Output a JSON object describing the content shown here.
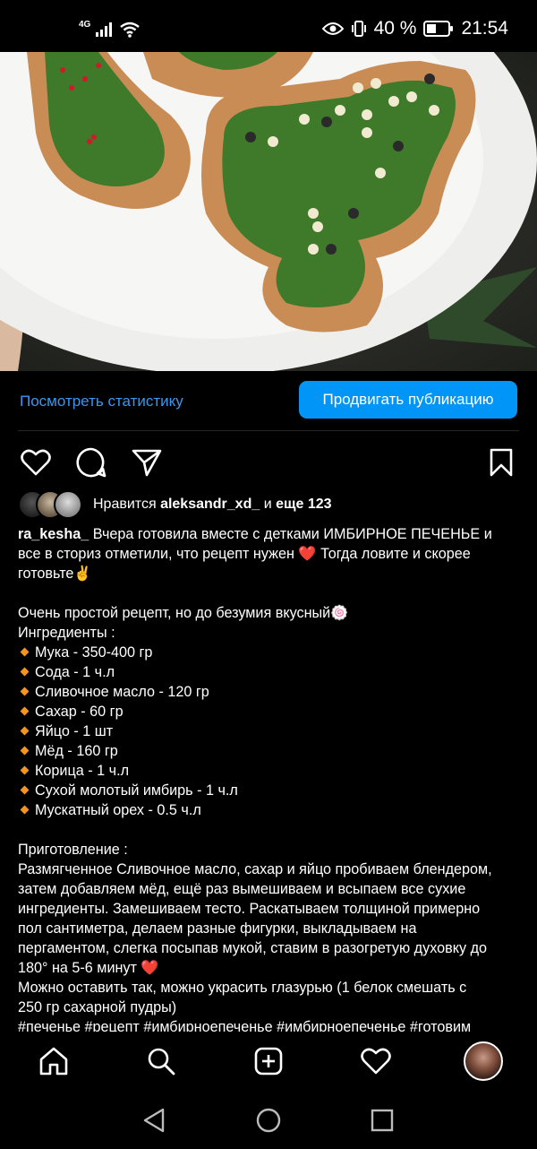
{
  "status_bar": {
    "network": "4G",
    "battery": "40 %",
    "time": "21:54"
  },
  "post": {
    "image_icon": "gingerbread-cookies-photo",
    "stats_link": "Посмотреть статистику",
    "promote_button": "Продвигать публикацию",
    "likes": {
      "prefix": "Нравится",
      "user": "aleksandr_xd_",
      "middle": "и",
      "more": "еще 123"
    },
    "caption": {
      "username": "ra_kesha_",
      "first_line": "Вчера готовила вместе с детками ИМБИРНОЕ ПЕЧЕНЬЕ и",
      "lines": [
        "все в сториз отметили, что рецепт нужен ❤️ Тогда ловите и скорее",
        "готовьте✌️",
        "",
        "Очень простой рецепт, но до безумия вкусный🍥",
        "Ингредиенты :"
      ],
      "ingredients": [
        "Мука - 350-400 гр",
        "Сода - 1 ч.л",
        "Сливочное масло - 120 гр",
        "Сахар - 60 гр",
        "Яйцо - 1 шт",
        "Мёд - 160 гр",
        "Корица - 1 ч.л",
        "Сухой молотый имбирь - 1 ч.л",
        "Мускатный орех - 0.5 ч.л"
      ],
      "method_lines": [
        "",
        "Приготовление :",
        "Размягченное Сливочное масло, сахар и яйцо пробиваем блендером,",
        "затем добавляем мёд, ещё раз вымешиваем и всыпаем все сухие",
        "ингредиенты. Замешиваем тесто. Раскатываем толщиной примерно",
        "пол сантиметра, делаем разные фигурки, выкладываем на",
        "пергаментом, слегка посыпав мукой, ставим в разогретую духовку до",
        "180° на 5-6 минут ❤️",
        "Можно оставить так, можно украсить глазурью (1 белок смешать с",
        "250 гр сахарной пудры)",
        "#печенье #рецепт #имбирноепеченье #имбирноепеченье #готовим"
      ]
    }
  },
  "colors": {
    "accent": "#0095f6",
    "link": "#3897f0",
    "bullet": "#f7941d"
  }
}
